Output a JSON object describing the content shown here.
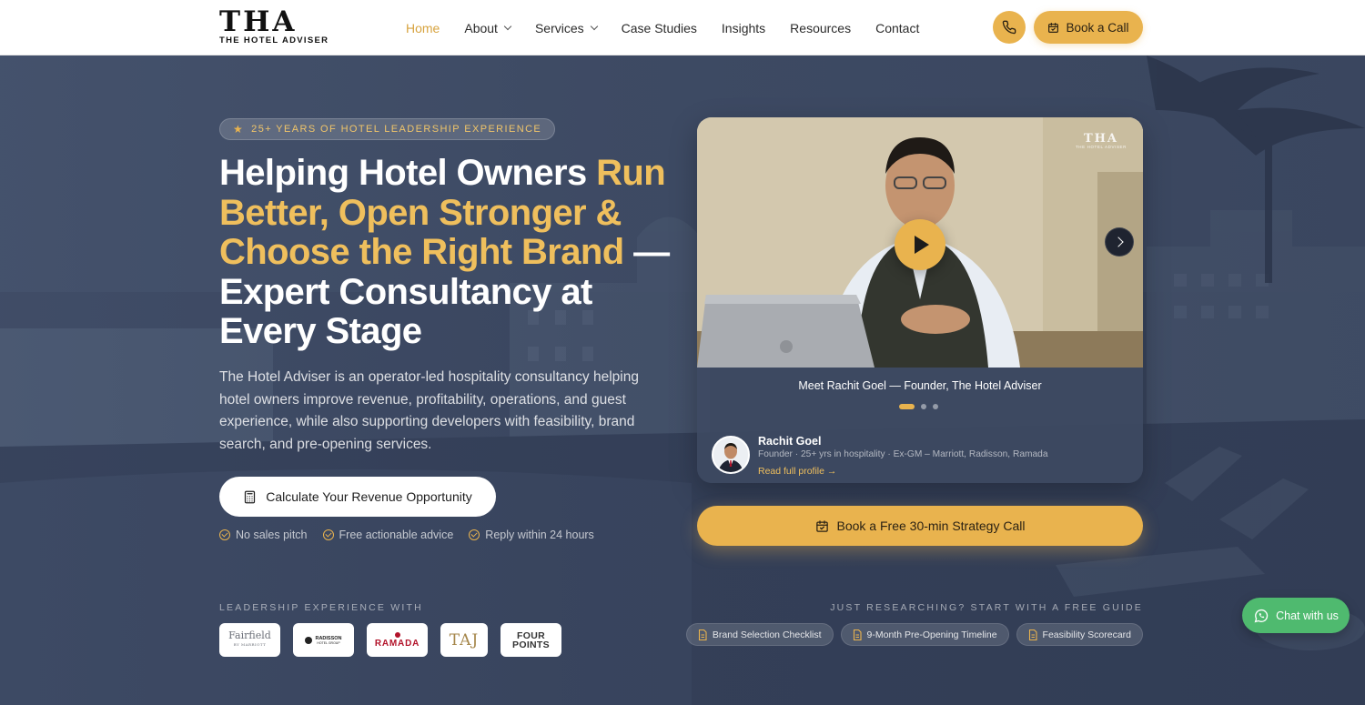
{
  "brand": {
    "logo_mark": "THA",
    "logo_sub": "THE HOTEL ADVISER"
  },
  "nav": {
    "items": [
      {
        "label": "Home",
        "active": true,
        "dropdown": false
      },
      {
        "label": "About",
        "active": false,
        "dropdown": true
      },
      {
        "label": "Services",
        "active": false,
        "dropdown": true
      },
      {
        "label": "Case Studies",
        "active": false,
        "dropdown": false
      },
      {
        "label": "Insights",
        "active": false,
        "dropdown": false
      },
      {
        "label": "Resources",
        "active": false,
        "dropdown": false
      },
      {
        "label": "Contact",
        "active": false,
        "dropdown": false
      }
    ],
    "phone_icon": "phone-icon",
    "book_label": "Book a Call"
  },
  "hero": {
    "badge": "25+ YEARS OF HOTEL LEADERSHIP EXPERIENCE",
    "headline_white_1": "Helping Hotel Owners ",
    "headline_gold": "Run Better, Open Stronger & Choose the Right Brand",
    "headline_white_2": " — Expert Consultancy at Every Stage",
    "lead": "The Hotel Adviser is an operator-led hospitality consultancy helping hotel owners improve revenue, profitability, operations, and guest experience, while also supporting developers with feasibility, brand search, and pre-opening services.",
    "cta_label": "Calculate Your Revenue Opportunity",
    "perks": [
      "No sales pitch",
      "Free actionable advice",
      "Reply within 24 hours"
    ]
  },
  "video_card": {
    "logo_mark": "THA",
    "logo_sub": "THE HOTEL ADVISER",
    "caption": "Meet Rachit Goel — Founder, The Hotel Adviser",
    "slides": 3,
    "active_slide": 1,
    "founder_name": "Rachit Goel",
    "founder_meta": "Founder · 25+ yrs in hospitality · Ex-GM – Marriott, Radisson, Ramada",
    "founder_link": "Read full profile →"
  },
  "strategy_cta": "Book a Free 30-min Strategy Call",
  "leadership": {
    "eyebrow": "LEADERSHIP EXPERIENCE WITH",
    "brands": [
      {
        "name": "Fairfield",
        "sub": "BY MARRIOTT"
      },
      {
        "name": "RADISSON",
        "sub": "HOTEL GROUP"
      },
      {
        "name": "RAMADA",
        "sub": ""
      },
      {
        "name": "TAJ",
        "sub": ""
      },
      {
        "name": "FOUR",
        "sub": "POINTS"
      }
    ]
  },
  "guides": {
    "eyebrow": "JUST RESEARCHING? START WITH A FREE GUIDE",
    "items": [
      "Brand Selection Checklist",
      "9-Month Pre-Opening Timeline",
      "Feasibility Scorecard"
    ]
  },
  "chat": {
    "label": "Chat with us"
  },
  "colors": {
    "accent": "#e9b34e",
    "accent_text": "#efbf5d",
    "hero_bg": "#3f4c67",
    "whatsapp": "#4fba6f"
  }
}
